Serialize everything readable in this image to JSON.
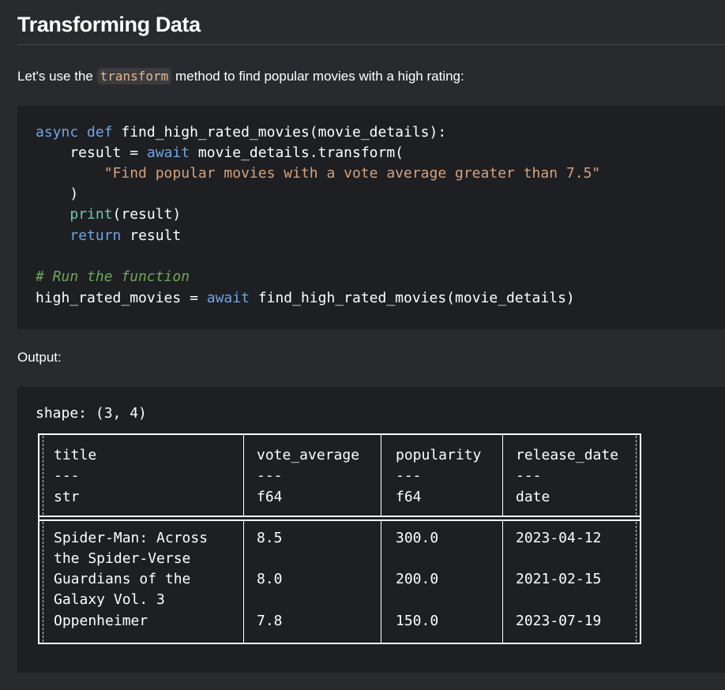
{
  "heading": "Transforming Data",
  "intro": {
    "before": "Let's use the ",
    "code": "transform",
    "after": " method to find popular movies with a high rating:"
  },
  "code": {
    "l1_kw": "async def",
    "l1_rest": " find_high_rated_movies(movie_details):",
    "l2_pre": "    result = ",
    "l2_kw": "await",
    "l2_rest": " movie_details.transform(",
    "l3_str": "        \"Find popular movies with a vote average greater than 7.5\"",
    "l4": "    )",
    "l5_pre": "    ",
    "l5_fn": "print",
    "l5_rest": "(result)",
    "l6_pre": "    ",
    "l6_kw": "return",
    "l6_rest": " result",
    "l8_comment": "# Run the function",
    "l9_pre": "high_rated_movies = ",
    "l9_kw": "await",
    "l9_rest": " find_high_rated_movies(movie_details)"
  },
  "output_label": "Output:",
  "output": {
    "shape": "shape: (3, 4)",
    "columns": [
      {
        "name": "title",
        "sep": "---",
        "dtype": "str"
      },
      {
        "name": "vote_average",
        "sep": "---",
        "dtype": "f64"
      },
      {
        "name": "popularity",
        "sep": "---",
        "dtype": "f64"
      },
      {
        "name": "release_date",
        "sep": "---",
        "dtype": "date"
      }
    ],
    "rows": [
      {
        "title_l1": "Spider-Man: Across",
        "title_l2": "the Spider-Verse",
        "vote_average": "8.5",
        "popularity": "300.0",
        "release_date": "2023-04-12"
      },
      {
        "title_l1": "Guardians of the",
        "title_l2": "Galaxy Vol. 3",
        "vote_average": "8.0",
        "popularity": "200.0",
        "release_date": "2021-02-15"
      },
      {
        "title_l1": "Oppenheimer",
        "title_l2": "",
        "vote_average": "7.8",
        "popularity": "150.0",
        "release_date": "2023-07-19"
      }
    ]
  }
}
